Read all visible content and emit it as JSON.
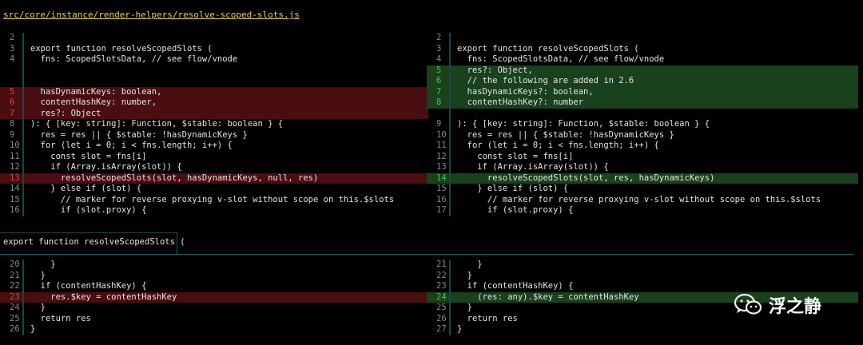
{
  "file_path": "src/core/instance/render-helpers/resolve-scoped-slots.js",
  "hunk_separator": "export function resolveScopedSlots (",
  "watermark": {
    "text": "浮之静",
    "icon": "wechat-icon"
  },
  "colors": {
    "deleted_bg": "#4a0d10",
    "added_bg": "#18411c",
    "deleted_word": "#8c1a21",
    "added_word": "#2a7a2e",
    "path": "#e8d44d"
  },
  "left_top": [
    {
      "n": "2",
      "t": "",
      "k": ""
    },
    {
      "n": "3",
      "t": "export function resolveScopedSlots (",
      "k": ""
    },
    {
      "n": "4",
      "t": "  fns: ScopedSlotsData, // see flow/vnode",
      "k": ""
    },
    {
      "n": "",
      "t": "",
      "k": ""
    },
    {
      "n": "",
      "t": "",
      "k": ""
    },
    {
      "n": "5",
      "t": "  hasDynamicKeys: boolean,",
      "k": "del"
    },
    {
      "n": "6",
      "t": "  contentHashKey: number,",
      "k": "del"
    },
    {
      "n": "7",
      "t": "  res?: Object",
      "k": "del"
    },
    {
      "n": "8",
      "t": "): { [key: string]: Function, $stable: boolean } {",
      "k": ""
    },
    {
      "n": "9",
      "t": "  res = res || { $stable: !hasDynamicKeys }",
      "k": ""
    },
    {
      "n": "10",
      "t": "  for (let i = 0; i < fns.length; i++) {",
      "k": ""
    },
    {
      "n": "11",
      "t": "    const slot = fns[i]",
      "k": ""
    },
    {
      "n": "12",
      "t": "    if (Array.isArray(slot)) {",
      "k": ""
    },
    {
      "n": "13",
      "t": "      resolveScopedSlots(slot, hasDynamicKeys, null, res)",
      "k": "del"
    },
    {
      "n": "14",
      "t": "    } else if (slot) {",
      "k": ""
    },
    {
      "n": "15",
      "t": "      // marker for reverse proxying v-slot without scope on this.$slots",
      "k": ""
    },
    {
      "n": "16",
      "t": "      if (slot.proxy) {",
      "k": ""
    }
  ],
  "right_top": [
    {
      "n": "2",
      "t": "",
      "k": ""
    },
    {
      "n": "3",
      "t": "export function resolveScopedSlots (",
      "k": ""
    },
    {
      "n": "4",
      "t": "  fns: ScopedSlotsData, // see flow/vnode",
      "k": ""
    },
    {
      "n": "5",
      "t": "  res?: Object,",
      "k": "add"
    },
    {
      "n": "6",
      "t": "  // the following are added in 2.6",
      "k": "add"
    },
    {
      "n": "7",
      "t": "  hasDynamicKeys?: boolean,",
      "k": "add"
    },
    {
      "n": "8",
      "t": "  contentHashKey?: number",
      "k": "add"
    },
    {
      "n": "",
      "t": "",
      "k": ""
    },
    {
      "n": "9",
      "t": "): { [key: string]: Function, $stable: boolean } {",
      "k": ""
    },
    {
      "n": "10",
      "t": "  res = res || { $stable: !hasDynamicKeys }",
      "k": ""
    },
    {
      "n": "11",
      "t": "  for (let i = 0; i < fns.length; i++) {",
      "k": ""
    },
    {
      "n": "12",
      "t": "    const slot = fns[i]",
      "k": ""
    },
    {
      "n": "13",
      "t": "    if (Array.isArray(slot)) {",
      "k": ""
    },
    {
      "n": "14",
      "t": "      resolveScopedSlots(slot, res, hasDynamicKeys)",
      "k": "add"
    },
    {
      "n": "15",
      "t": "    } else if (slot) {",
      "k": ""
    },
    {
      "n": "16",
      "t": "      // marker for reverse proxying v-slot without scope on this.$slots",
      "k": ""
    },
    {
      "n": "17",
      "t": "      if (slot.proxy) {",
      "k": ""
    }
  ],
  "left_bottom": [
    {
      "n": "20",
      "t": "    }",
      "k": ""
    },
    {
      "n": "21",
      "t": "  }",
      "k": ""
    },
    {
      "n": "22",
      "t": "  if (contentHashKey) {",
      "k": ""
    },
    {
      "n": "23",
      "t": "    res.$key = contentHashKey",
      "k": "del"
    },
    {
      "n": "24",
      "t": "  }",
      "k": ""
    },
    {
      "n": "25",
      "t": "  return res",
      "k": ""
    },
    {
      "n": "26",
      "t": "}",
      "k": ""
    }
  ],
  "right_bottom": [
    {
      "n": "21",
      "t": "    }",
      "k": ""
    },
    {
      "n": "22",
      "t": "  }",
      "k": ""
    },
    {
      "n": "23",
      "t": "  if (contentHashKey) {",
      "k": ""
    },
    {
      "n": "24",
      "t": "    (res: any).$key = contentHashKey",
      "k": "add"
    },
    {
      "n": "25",
      "t": "  }",
      "k": ""
    },
    {
      "n": "26",
      "t": "  return res",
      "k": ""
    },
    {
      "n": "27",
      "t": "}",
      "k": ""
    }
  ]
}
